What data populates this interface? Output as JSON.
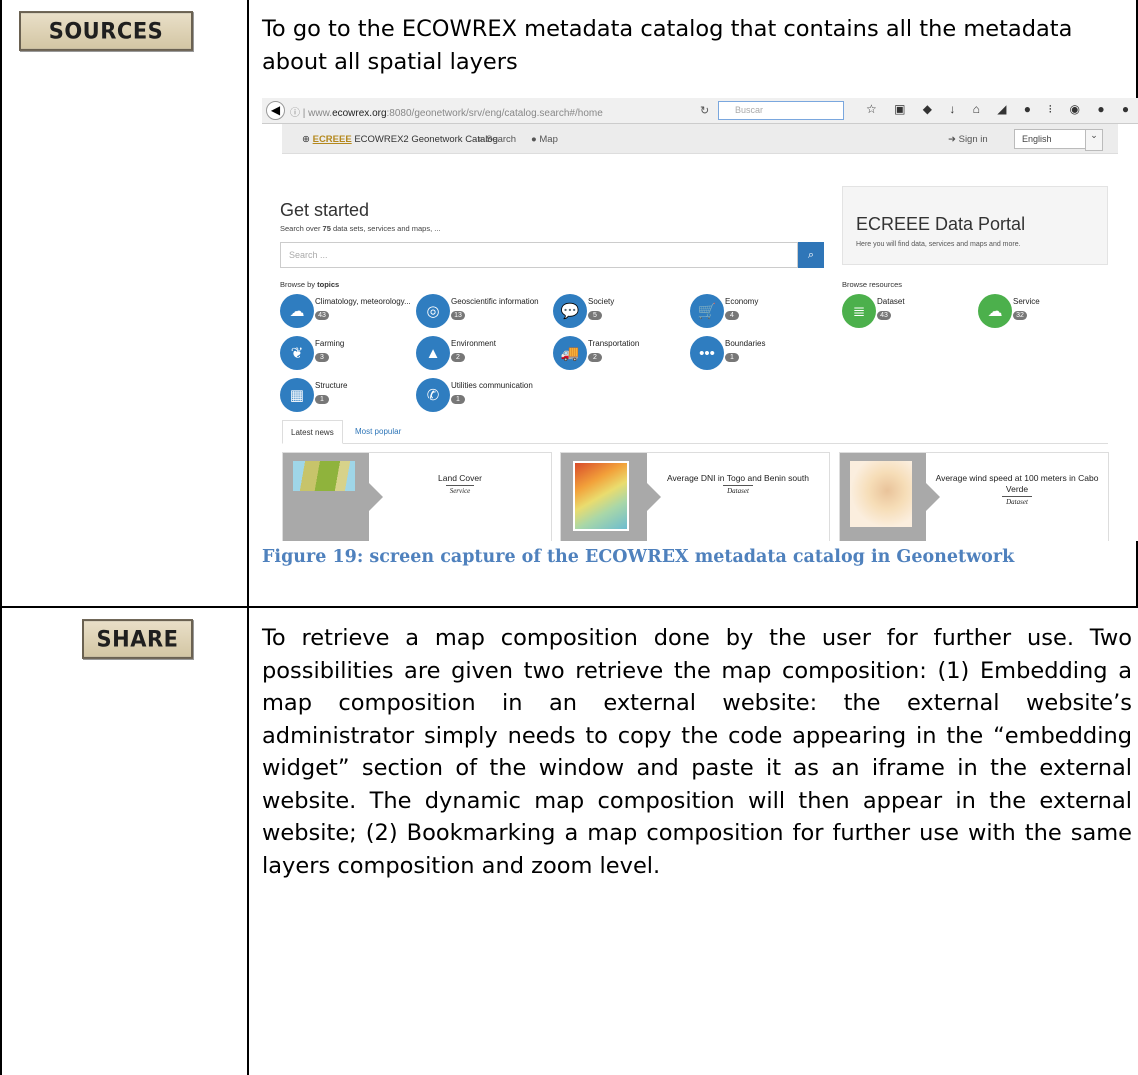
{
  "row1": {
    "tag": "SOURCES",
    "text": "To go to the ECOWREX metadata catalog that contains all the metadata about all spatial layers",
    "caption": "Figure 19: screen capture of the ECOWREX metadata catalog in Geonetwork"
  },
  "row2": {
    "tag": "SHARE",
    "text": "To retrieve a map composition done by the user for further use. Two possibilities are given two retrieve the map composition: (1) Embedding a map composition in an external website: the external website’s administrator simply needs to copy the code appearing in the “embedding widget” section of the window and paste it as an iframe in the external website. The dynamic map composition will then appear in the external website; (2) Bookmarking a map composition for further use with the same layers composition and zoom level."
  },
  "screenshot": {
    "url_prefix": "www.",
    "url_host": "ecowrex.org",
    "url_rest": ":8080/geonetwork/srv/eng/catalog.search#/home",
    "browser_search": "Buscar",
    "brand_logo": "ECREEE",
    "brand_text": "ECOWREX2 Geonetwork Catalog",
    "nav_search": "Search",
    "nav_map": "Map",
    "sign_in": "Sign in",
    "language": "English",
    "get_started": "Get started",
    "search_over_prefix": "Search over ",
    "search_over_count": "75",
    "search_over_suffix": " data sets, services and maps, ...",
    "search_placeholder": "Search ...",
    "portal_title": "ECREEE Data Portal",
    "portal_sub": "Here you will find data, services and maps and more.",
    "browse_by": "Browse by ",
    "browse_topics": "topics",
    "browse_resources": "Browse resources",
    "topics": [
      {
        "name": "Climatology, meteorology...",
        "count": "43",
        "icon": "cloud-icon"
      },
      {
        "name": "Geoscientific information",
        "count": "13",
        "icon": "target-icon"
      },
      {
        "name": "Society",
        "count": "5",
        "icon": "chat-icon"
      },
      {
        "name": "Economy",
        "count": "4",
        "icon": "cart-icon"
      },
      {
        "name": "Farming",
        "count": "3",
        "icon": "leaf-icon"
      },
      {
        "name": "Environment",
        "count": "2",
        "icon": "tree-icon"
      },
      {
        "name": "Transportation",
        "count": "2",
        "icon": "truck-icon"
      },
      {
        "name": "Boundaries",
        "count": "1",
        "icon": "dots-icon"
      },
      {
        "name": "Structure",
        "count": "1",
        "icon": "building-icon"
      },
      {
        "name": "Utilities communication",
        "count": "1",
        "icon": "phone-icon"
      }
    ],
    "resources": [
      {
        "name": "Dataset",
        "count": "43",
        "icon": "database-icon"
      },
      {
        "name": "Service",
        "count": "32",
        "icon": "cloud-icon"
      }
    ],
    "tabs": [
      "Latest news",
      "Most popular"
    ],
    "cards": [
      {
        "title": "Land Cover",
        "type": "Service"
      },
      {
        "title": "Average DNI in Togo and Benin south",
        "type": "Dataset"
      },
      {
        "title": "Average wind speed at 100 meters in Cabo Verde",
        "type": "Dataset"
      }
    ]
  }
}
